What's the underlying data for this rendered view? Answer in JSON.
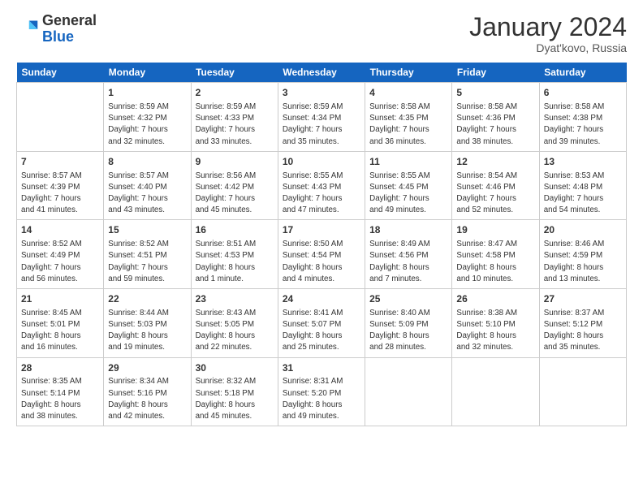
{
  "header": {
    "logo_general": "General",
    "logo_blue": "Blue",
    "title": "January 2024",
    "subtitle": "Dyat'kovo, Russia"
  },
  "columns": [
    "Sunday",
    "Monday",
    "Tuesday",
    "Wednesday",
    "Thursday",
    "Friday",
    "Saturday"
  ],
  "weeks": [
    [
      {
        "day": "",
        "detail": ""
      },
      {
        "day": "1",
        "detail": "Sunrise: 8:59 AM\nSunset: 4:32 PM\nDaylight: 7 hours\nand 32 minutes."
      },
      {
        "day": "2",
        "detail": "Sunrise: 8:59 AM\nSunset: 4:33 PM\nDaylight: 7 hours\nand 33 minutes."
      },
      {
        "day": "3",
        "detail": "Sunrise: 8:59 AM\nSunset: 4:34 PM\nDaylight: 7 hours\nand 35 minutes."
      },
      {
        "day": "4",
        "detail": "Sunrise: 8:58 AM\nSunset: 4:35 PM\nDaylight: 7 hours\nand 36 minutes."
      },
      {
        "day": "5",
        "detail": "Sunrise: 8:58 AM\nSunset: 4:36 PM\nDaylight: 7 hours\nand 38 minutes."
      },
      {
        "day": "6",
        "detail": "Sunrise: 8:58 AM\nSunset: 4:38 PM\nDaylight: 7 hours\nand 39 minutes."
      }
    ],
    [
      {
        "day": "7",
        "detail": "Sunrise: 8:57 AM\nSunset: 4:39 PM\nDaylight: 7 hours\nand 41 minutes."
      },
      {
        "day": "8",
        "detail": "Sunrise: 8:57 AM\nSunset: 4:40 PM\nDaylight: 7 hours\nand 43 minutes."
      },
      {
        "day": "9",
        "detail": "Sunrise: 8:56 AM\nSunset: 4:42 PM\nDaylight: 7 hours\nand 45 minutes."
      },
      {
        "day": "10",
        "detail": "Sunrise: 8:55 AM\nSunset: 4:43 PM\nDaylight: 7 hours\nand 47 minutes."
      },
      {
        "day": "11",
        "detail": "Sunrise: 8:55 AM\nSunset: 4:45 PM\nDaylight: 7 hours\nand 49 minutes."
      },
      {
        "day": "12",
        "detail": "Sunrise: 8:54 AM\nSunset: 4:46 PM\nDaylight: 7 hours\nand 52 minutes."
      },
      {
        "day": "13",
        "detail": "Sunrise: 8:53 AM\nSunset: 4:48 PM\nDaylight: 7 hours\nand 54 minutes."
      }
    ],
    [
      {
        "day": "14",
        "detail": "Sunrise: 8:52 AM\nSunset: 4:49 PM\nDaylight: 7 hours\nand 56 minutes."
      },
      {
        "day": "15",
        "detail": "Sunrise: 8:52 AM\nSunset: 4:51 PM\nDaylight: 7 hours\nand 59 minutes."
      },
      {
        "day": "16",
        "detail": "Sunrise: 8:51 AM\nSunset: 4:53 PM\nDaylight: 8 hours\nand 1 minute."
      },
      {
        "day": "17",
        "detail": "Sunrise: 8:50 AM\nSunset: 4:54 PM\nDaylight: 8 hours\nand 4 minutes."
      },
      {
        "day": "18",
        "detail": "Sunrise: 8:49 AM\nSunset: 4:56 PM\nDaylight: 8 hours\nand 7 minutes."
      },
      {
        "day": "19",
        "detail": "Sunrise: 8:47 AM\nSunset: 4:58 PM\nDaylight: 8 hours\nand 10 minutes."
      },
      {
        "day": "20",
        "detail": "Sunrise: 8:46 AM\nSunset: 4:59 PM\nDaylight: 8 hours\nand 13 minutes."
      }
    ],
    [
      {
        "day": "21",
        "detail": "Sunrise: 8:45 AM\nSunset: 5:01 PM\nDaylight: 8 hours\nand 16 minutes."
      },
      {
        "day": "22",
        "detail": "Sunrise: 8:44 AM\nSunset: 5:03 PM\nDaylight: 8 hours\nand 19 minutes."
      },
      {
        "day": "23",
        "detail": "Sunrise: 8:43 AM\nSunset: 5:05 PM\nDaylight: 8 hours\nand 22 minutes."
      },
      {
        "day": "24",
        "detail": "Sunrise: 8:41 AM\nSunset: 5:07 PM\nDaylight: 8 hours\nand 25 minutes."
      },
      {
        "day": "25",
        "detail": "Sunrise: 8:40 AM\nSunset: 5:09 PM\nDaylight: 8 hours\nand 28 minutes."
      },
      {
        "day": "26",
        "detail": "Sunrise: 8:38 AM\nSunset: 5:10 PM\nDaylight: 8 hours\nand 32 minutes."
      },
      {
        "day": "27",
        "detail": "Sunrise: 8:37 AM\nSunset: 5:12 PM\nDaylight: 8 hours\nand 35 minutes."
      }
    ],
    [
      {
        "day": "28",
        "detail": "Sunrise: 8:35 AM\nSunset: 5:14 PM\nDaylight: 8 hours\nand 38 minutes."
      },
      {
        "day": "29",
        "detail": "Sunrise: 8:34 AM\nSunset: 5:16 PM\nDaylight: 8 hours\nand 42 minutes."
      },
      {
        "day": "30",
        "detail": "Sunrise: 8:32 AM\nSunset: 5:18 PM\nDaylight: 8 hours\nand 45 minutes."
      },
      {
        "day": "31",
        "detail": "Sunrise: 8:31 AM\nSunset: 5:20 PM\nDaylight: 8 hours\nand 49 minutes."
      },
      {
        "day": "",
        "detail": ""
      },
      {
        "day": "",
        "detail": ""
      },
      {
        "day": "",
        "detail": ""
      }
    ]
  ]
}
